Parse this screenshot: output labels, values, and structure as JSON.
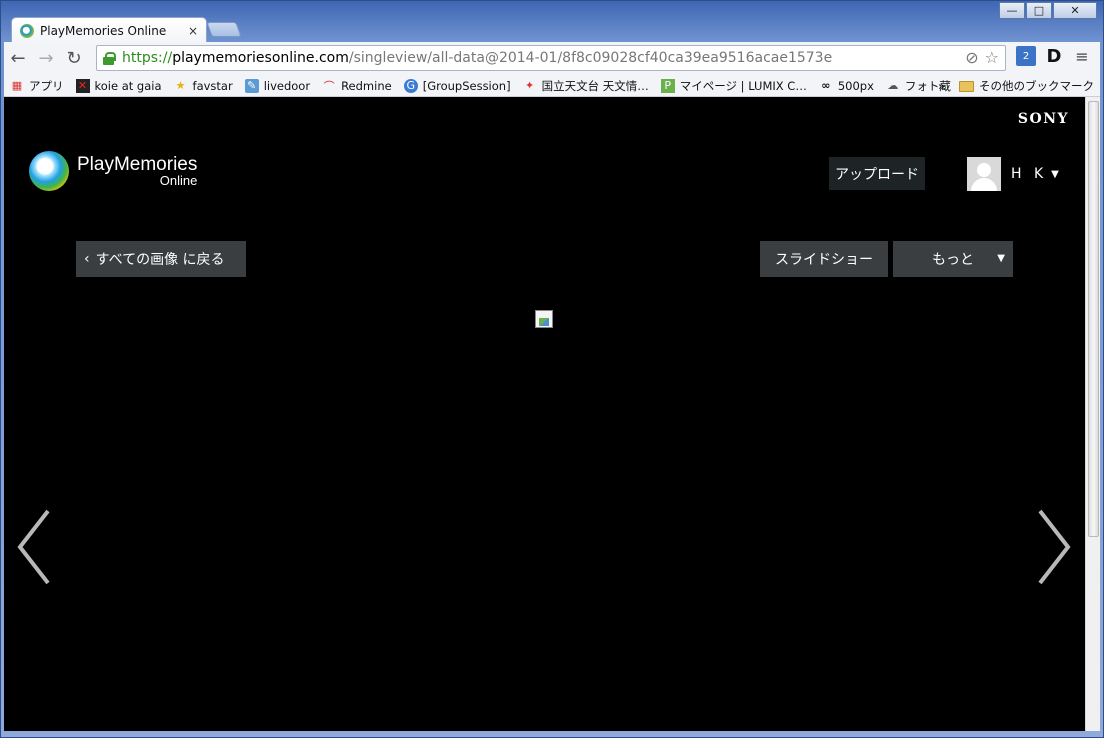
{
  "window": {
    "minimize_label": "—",
    "maximize_label": "□",
    "close_label": "✕"
  },
  "tab": {
    "title": "PlayMemories Online",
    "close_label": "×"
  },
  "toolbar": {
    "back_label": "←",
    "forward_label": "→",
    "reload_label": "↻",
    "url_scheme": "https://",
    "url_host": "playmemoriesonline.com",
    "url_path": "/singleview/all-data@2014-01/8f8c09028cf40ca39ea9516acae1573e",
    "star_label": "☆",
    "menu_label": "≡",
    "ext_d_label": "D"
  },
  "bookmarks": {
    "items": [
      {
        "label": "アプリ",
        "icon": "apps-grid-icon"
      },
      {
        "label": "koie at gaia",
        "icon": "x-icon"
      },
      {
        "label": "favstar",
        "icon": "star-icon"
      },
      {
        "label": "livedoor",
        "icon": "livedoor-icon"
      },
      {
        "label": "Redmine",
        "icon": "redmine-icon"
      },
      {
        "label": "[GroupSession]",
        "icon": "groupsession-icon"
      },
      {
        "label": "国立天文台 天文情…",
        "icon": "nao-icon"
      },
      {
        "label": "マイページ | LUMIX C…",
        "icon": "lumix-icon"
      },
      {
        "label": "500px",
        "icon": "500px-icon"
      },
      {
        "label": "フォト蔵",
        "icon": "photozou-icon"
      }
    ],
    "overflow_label": "»",
    "other_label": "その他のブックマーク"
  },
  "page": {
    "brand": "SONY",
    "logo_main": "PlayMemories",
    "logo_sub": "Online",
    "upload_label": "アップロード",
    "user_name": "H K",
    "back_label": "すべての画像 に戻る",
    "slideshow_label": "スライドショー",
    "more_label": "もっと"
  }
}
